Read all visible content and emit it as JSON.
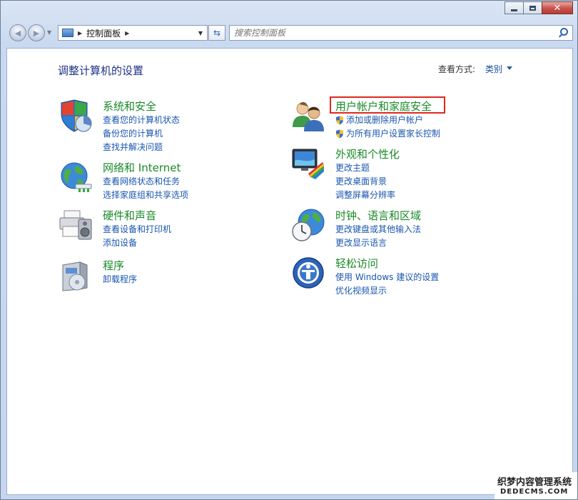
{
  "nav": {
    "breadcrumb": "控制面板",
    "search_placeholder": "搜索控制面板"
  },
  "content": {
    "title": "调整计算机的设置",
    "view_by_label": "查看方式:",
    "view_by_value": "类别"
  },
  "categories": [
    {
      "title": "系统和安全",
      "links": [
        "查看您的计算机状态",
        "备份您的计算机",
        "查找并解决问题"
      ]
    },
    {
      "title": "网络和 Internet",
      "links": [
        "查看网络状态和任务",
        "选择家庭组和共享选项"
      ]
    },
    {
      "title": "硬件和声音",
      "links": [
        "查看设备和打印机",
        "添加设备"
      ]
    },
    {
      "title": "程序",
      "links": [
        "卸载程序"
      ]
    },
    {
      "title": "用户帐户和家庭安全",
      "links": [
        "添加或删除用户帐户",
        "为所有用户设置家长控制"
      ]
    },
    {
      "title": "外观和个性化",
      "links": [
        "更改主题",
        "更改桌面背景",
        "调整屏幕分辨率"
      ]
    },
    {
      "title": "时钟、语言和区域",
      "links": [
        "更改键盘或其他输入法",
        "更改显示语言"
      ]
    },
    {
      "title": "轻松访问",
      "links": [
        "使用 Windows 建议的设置",
        "优化视频显示"
      ]
    }
  ],
  "icons": {
    "system_security": "shield-pie-icon",
    "network": "globe-network-icon",
    "hardware": "printer-speaker-icon",
    "programs": "software-box-icon",
    "user_accounts": "users-icon",
    "appearance": "monitor-paint-icon",
    "clock_language": "globe-clock-icon",
    "ease_of_access": "accessibility-icon",
    "uac_shield": "uac-shield-icon"
  },
  "colors": {
    "category_title": "#198a27",
    "link": "#1a56b0",
    "highlight_box": "#e02820"
  },
  "watermark": {
    "line1": "织梦内容管理系统",
    "line2": "DEDECMS.COM"
  }
}
